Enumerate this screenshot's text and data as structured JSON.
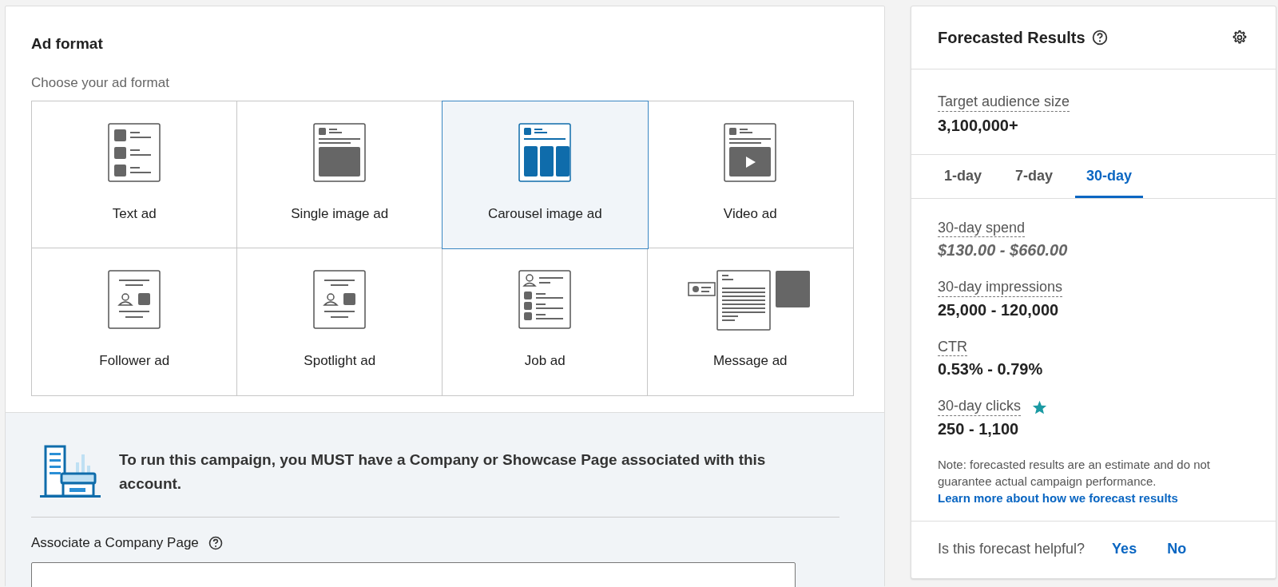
{
  "ad_format": {
    "title": "Ad format",
    "subtitle": "Choose your ad format",
    "formats": [
      {
        "kind": "text",
        "label": "Text ad",
        "selected": false
      },
      {
        "kind": "single-image",
        "label": "Single image ad",
        "selected": false
      },
      {
        "kind": "carousel",
        "label": "Carousel image ad",
        "selected": true
      },
      {
        "kind": "video",
        "label": "Video ad",
        "selected": false
      },
      {
        "kind": "follower",
        "label": "Follower ad",
        "selected": false
      },
      {
        "kind": "spotlight",
        "label": "Spotlight ad",
        "selected": false
      },
      {
        "kind": "job",
        "label": "Job ad",
        "selected": false
      },
      {
        "kind": "message",
        "label": "Message ad",
        "selected": false
      }
    ]
  },
  "company_page": {
    "notice": "To run this campaign, you MUST have a Company or Showcase Page associated with this account.",
    "field_label": "Associate a Company Page"
  },
  "forecast": {
    "title": "Forecasted Results",
    "audience_label": "Target audience size",
    "audience_value": "3,100,000+",
    "tabs": [
      {
        "label": "1-day",
        "selected": false
      },
      {
        "label": "7-day",
        "selected": false
      },
      {
        "label": "30-day",
        "selected": true
      }
    ],
    "metrics": [
      {
        "kind": "estimate",
        "label": "30-day spend",
        "value": "$130.00 - $660.00",
        "starred": false
      },
      {
        "kind": "count",
        "label": "30-day impressions",
        "value": "25,000 - 120,000",
        "starred": false
      },
      {
        "kind": "count",
        "label": "CTR",
        "value": "0.53% - 0.79%",
        "starred": false
      },
      {
        "kind": "count",
        "label": "30-day clicks",
        "value": "250 - 1,100",
        "starred": true
      }
    ],
    "note": "Note: forecasted results are an estimate and do not guarantee actual campaign performance.",
    "learn_more_link": "Learn more about how we forecast results",
    "feedback": {
      "question": "Is this forecast helpful?",
      "buttons": [
        "Yes",
        "No"
      ]
    }
  }
}
